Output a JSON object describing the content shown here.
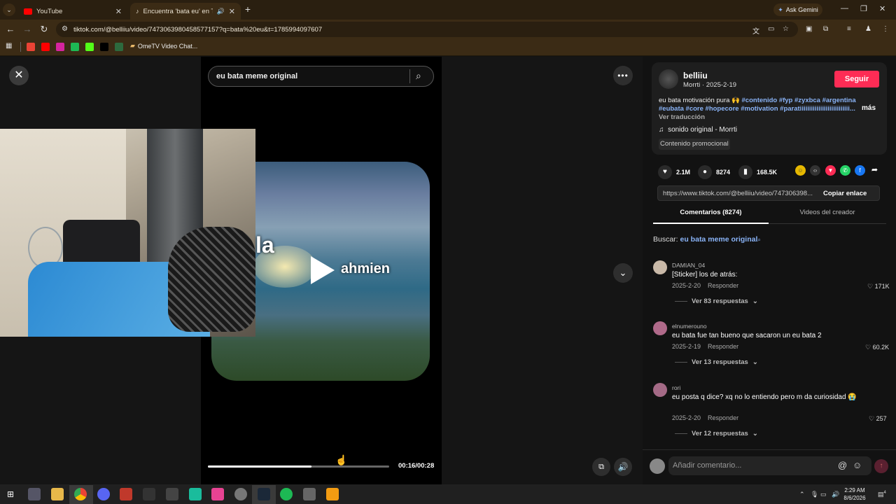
{
  "browser": {
    "tabs": [
      {
        "title": "YouTube",
        "icon": "youtube-icon"
      },
      {
        "title": "Encuentra 'bata eu' en TikT",
        "icon": "tiktok-icon",
        "active": true
      }
    ],
    "ask_gemini": "Ask Gemini",
    "url": "tiktok.com/@belliiu/video/7473063980458577157?q=bata%20eu&t=1785994097607",
    "bookmarks": [
      {
        "icon": "gmail-icon",
        "color": "#ea4335"
      },
      {
        "icon": "youtube-icon",
        "color": "#ff0000"
      },
      {
        "icon": "instagram-icon",
        "color": "#d6249f"
      },
      {
        "icon": "app-icon-green",
        "color": "#1db954"
      },
      {
        "icon": "kick-icon",
        "color": "#53fc18"
      },
      {
        "icon": "tiktok-icon",
        "color": "#000000"
      },
      {
        "icon": "app-icon-s",
        "color": "#2d6a3e"
      }
    ],
    "bookmark_ome": "OmeTV Video Chat..."
  },
  "video": {
    "search_query": "eu bata meme original",
    "caption_left": "la",
    "caption_right": "ahmien",
    "time": "00:16/00:28",
    "progress": 0.57
  },
  "post": {
    "username": "belliiu",
    "subtitle": "Morrti · 2025-2-19",
    "follow_label": "Seguir",
    "desc_text": "eu bata motivación pura 🙌 ",
    "desc_tags": "#contenido #fyp #zyxbca #argentina #eubata #core #hopecore #motivation #paratiiiiiiiiiiiiiiiiiiiiiiiiiii...",
    "more_label": "más",
    "translate_label": "Ver traducción",
    "sound": "sonido original - Morrti",
    "promo_label": "Contenido promocional",
    "likes": "2.1M",
    "comments_count": "8274",
    "saves": "168.5K",
    "link": "https://www.tiktok.com/@belliiu/video/747306398...",
    "copy_label": "Copiar enlace",
    "tab_comments": "Comentarios (8274)",
    "tab_creator": "Videos del creador",
    "search_prefix": "Buscar: ",
    "search_term": "eu bata meme original"
  },
  "comments": [
    {
      "user": "DAMIAN_04",
      "text": "[Sticker] los de atrás:",
      "date": "2025-2-20",
      "reply": "Responder",
      "likes": "171K",
      "more": "Ver 83 respuestas",
      "avatar_color": "#c9b9a8"
    },
    {
      "user": "elnumerouno",
      "text": "eu bata fue tan bueno que sacaron un eu bata 2",
      "date": "2025-2-19",
      "reply": "Responder",
      "likes": "60.2K",
      "more": "Ver 13 respuestas",
      "avatar_color": "#b06a8a"
    },
    {
      "user": "rori",
      "text": "eu posta q dice? xq no lo entiendo pero m da curiosidad 😭",
      "date": "2025-2-20",
      "reply": "Responder",
      "likes": "257",
      "more": "Ver 12 respuestas",
      "avatar_color": "#a46a86"
    }
  ],
  "comment_input_placeholder": "Añadir comentario...",
  "taskbar": {
    "time": "2:29 AM",
    "date": "8/6/2026",
    "notifications": "4"
  }
}
